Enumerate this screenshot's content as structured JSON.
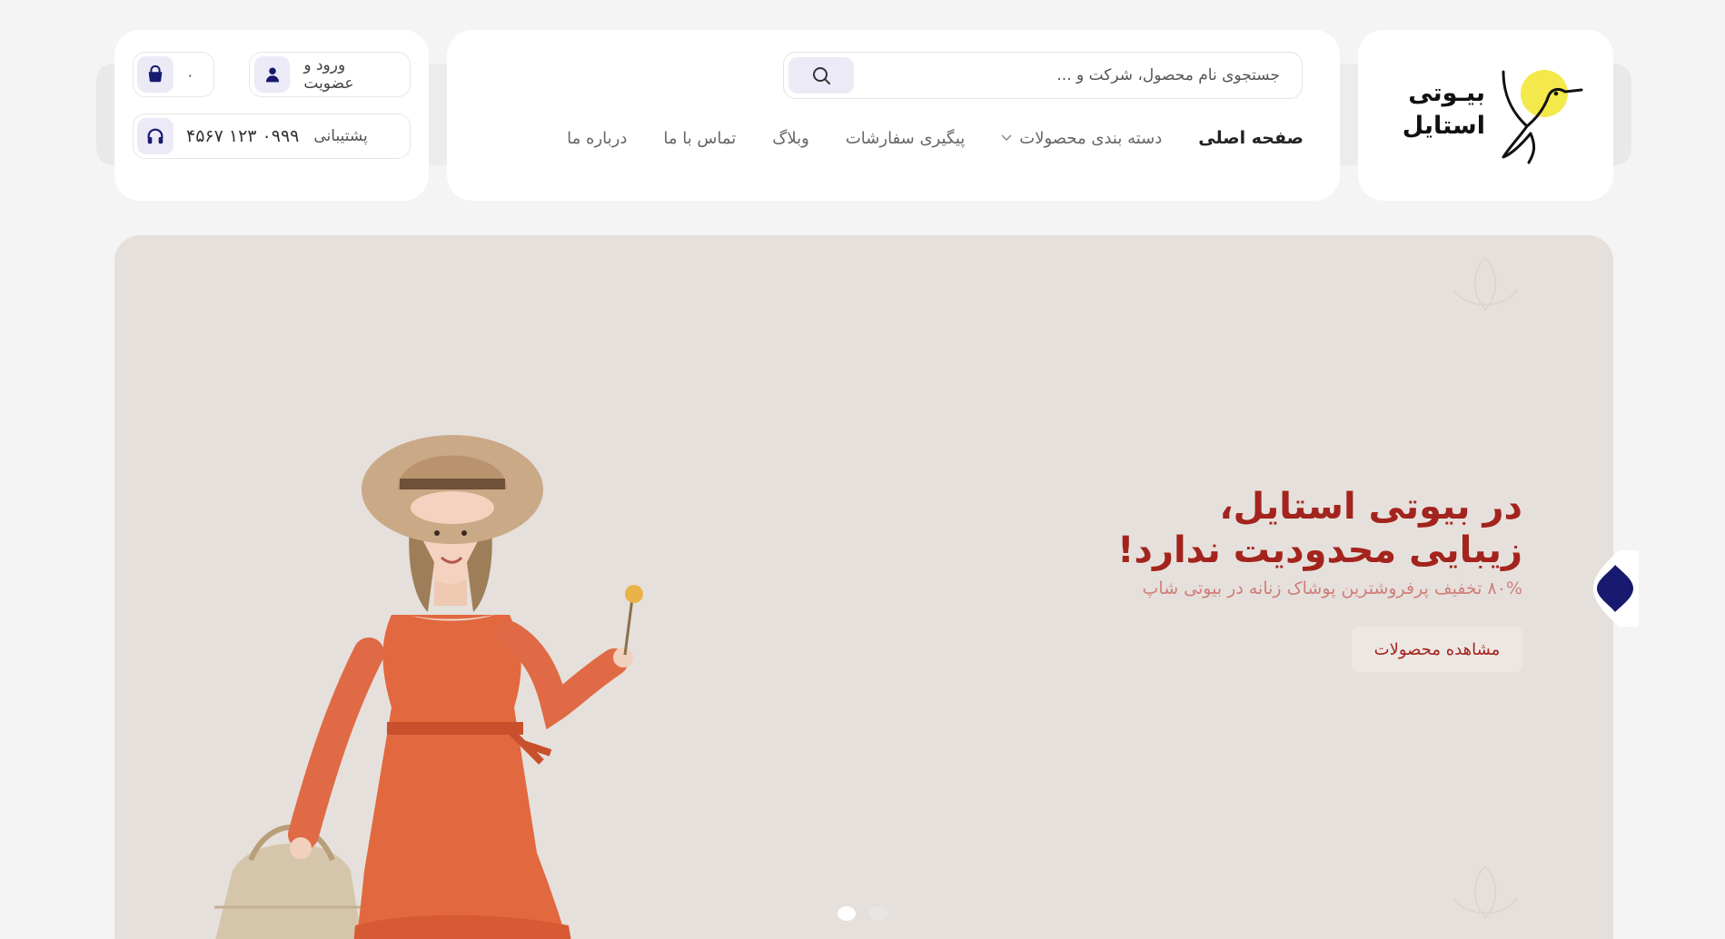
{
  "header": {
    "logo": {
      "line1": "بیـوتی",
      "line2": "استایل",
      "accent": "#f4e94a"
    },
    "search": {
      "placeholder": "جستجوی نام محصول، شرکت و ..."
    },
    "nav": [
      {
        "label": "صفحه اصلی",
        "active": true
      },
      {
        "label": "دسته بندی محصولات",
        "has_dropdown": true
      },
      {
        "label": "پیگیری سفارشات"
      },
      {
        "label": "وبلاگ"
      },
      {
        "label": "تماس با ما"
      },
      {
        "label": "درباره ما"
      }
    ],
    "user": {
      "cart_count": "۰",
      "login_label": "ورود و عضویت",
      "support_label": "پشتیبانی",
      "support_phone": "۰۹۹۹ ۱۲۳ ۴۵۶۷"
    }
  },
  "hero": {
    "title_line1": "در بیوتی استایل،",
    "title_line2": "زیبایی محدودیت ندارد!",
    "subtitle": "۸۰% تخفیف پرفروشترین پوشاک زنانه در بیوتی شاپ",
    "cta": "مشاهده محصولات",
    "slides": 2,
    "active_slide": 1
  },
  "colors": {
    "brand_navy": "#171a6e",
    "hero_red": "#a3241d",
    "hero_bg": "#e6e0dc",
    "icon_bg": "#ebeaf6"
  }
}
